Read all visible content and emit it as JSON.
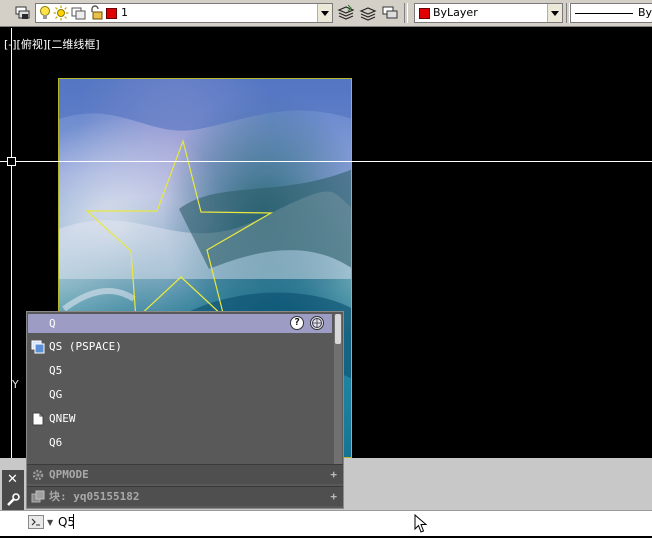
{
  "toolbar": {
    "layer_value": "1",
    "color_value": "ByLayer",
    "linetype_value": "By"
  },
  "viewport": {
    "view_label": "[-][俯视][二维线框]",
    "ucs_label": "Y"
  },
  "autocomplete": {
    "input_text": "Q",
    "items": [
      {
        "label": "QS (PSPACE)",
        "icon": "viewport-icon"
      },
      {
        "label": "Q5",
        "icon": ""
      },
      {
        "label": "QG",
        "icon": ""
      },
      {
        "label": "QNEW",
        "icon": "new-file-icon"
      },
      {
        "label": "Q6",
        "icon": ""
      }
    ],
    "groups": [
      {
        "label": "QPMODE",
        "icon": "gear-icon"
      },
      {
        "label": "块: yq05155182",
        "icon": "block-icon"
      }
    ]
  },
  "command_line": {
    "value": "Q5"
  },
  "colors": {
    "accent_header": "#9c9cc4",
    "popup_bg": "#595959",
    "star_outline": "#e8e840",
    "layer_red": "#e00000"
  }
}
